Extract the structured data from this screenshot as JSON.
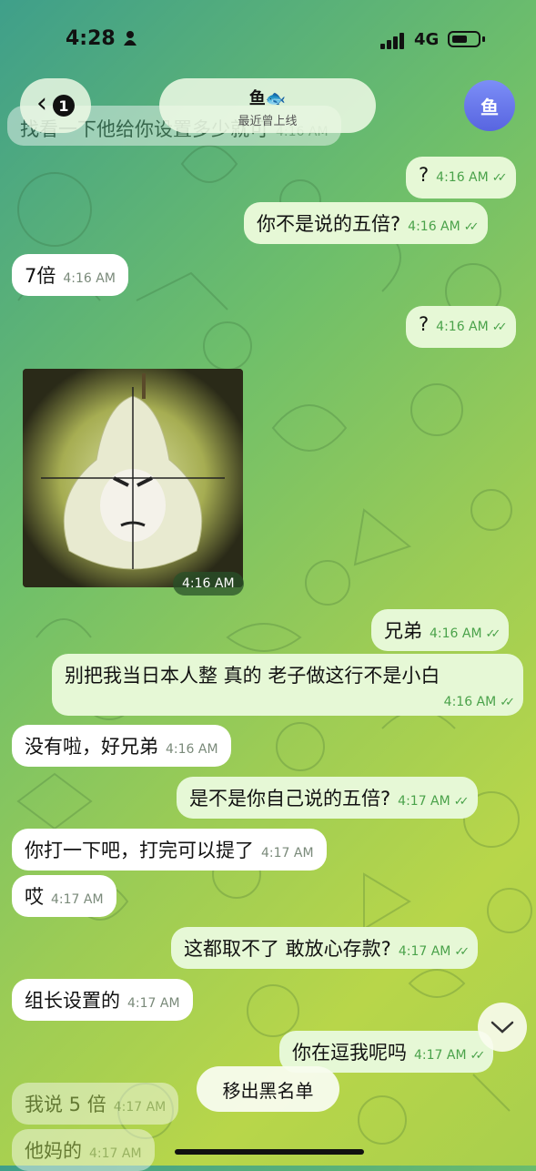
{
  "status": {
    "time": "4:28",
    "network": "4G"
  },
  "header": {
    "back_count": "1",
    "name": "鱼🐟",
    "subtitle": "最近曾上线",
    "avatar_text": "鱼"
  },
  "messages": [
    {
      "dir": "in",
      "text": "找看一下他给你设置多少就可",
      "time": "4:16 AM"
    },
    {
      "dir": "out",
      "text": "?",
      "time": "4:16 AM"
    },
    {
      "dir": "out",
      "text": "你不是说的五倍?",
      "time": "4:16 AM"
    },
    {
      "dir": "in",
      "text": "7倍",
      "time": "4:16 AM"
    },
    {
      "dir": "out",
      "text": "?",
      "time": "4:16 AM"
    },
    {
      "dir": "in",
      "type": "sticker",
      "time": "4:16 AM"
    },
    {
      "dir": "out",
      "text": "兄弟",
      "time": "4:16 AM"
    },
    {
      "dir": "out",
      "text": "别把我当日本人整 真的 老子做这行不是小白",
      "time": "4:16 AM"
    },
    {
      "dir": "in",
      "text": "没有啦，好兄弟",
      "time": "4:16 AM"
    },
    {
      "dir": "out",
      "text": "是不是你自己说的五倍?",
      "time": "4:17 AM"
    },
    {
      "dir": "in",
      "text": "你打一下吧，打完可以提了",
      "time": "4:17 AM"
    },
    {
      "dir": "in",
      "text": "哎",
      "time": "4:17 AM"
    },
    {
      "dir": "out",
      "text": "这都取不了 敢放心存款?",
      "time": "4:17 AM"
    },
    {
      "dir": "in",
      "text": "组长设置的",
      "time": "4:17 AM"
    },
    {
      "dir": "out",
      "text": "你在逗我呢吗",
      "time": "4:17 AM"
    },
    {
      "dir": "in",
      "text": "我说 5 倍",
      "time": "4:17 AM"
    },
    {
      "dir": "in",
      "text": "他妈的",
      "time": "4:17 AM"
    }
  ],
  "unblock_label": "移出黑名单",
  "colors": {
    "outgoing_bubble": "#e6f8d6",
    "incoming_bubble": "#ffffff",
    "check": "#4aa24a",
    "avatar": "#6a78ec"
  },
  "icons": {
    "back": "chevron-left-icon",
    "scroll": "chevron-down-icon",
    "read": "double-check-icon"
  }
}
